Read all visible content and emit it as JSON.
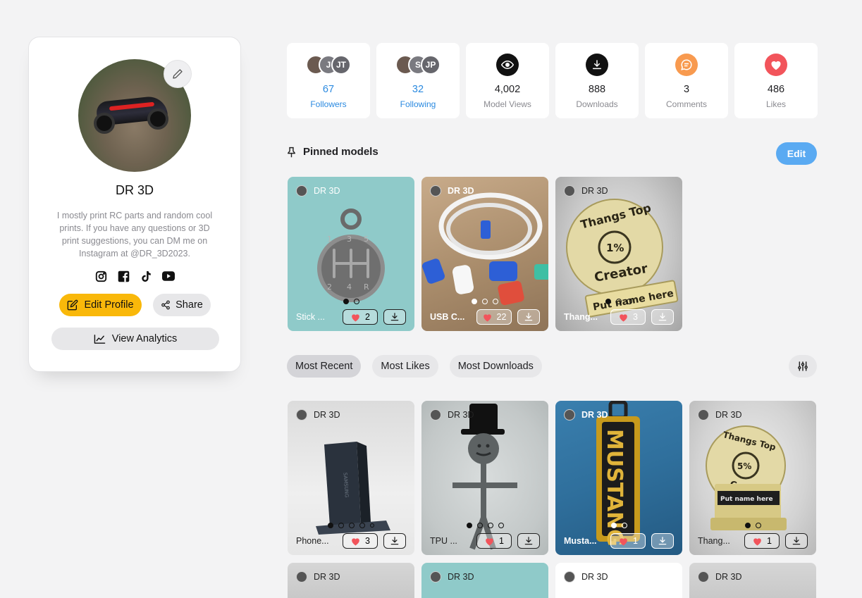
{
  "profile": {
    "name": "DR 3D",
    "bio": "I mostly print RC parts and random cool prints. If you have any questions or 3D print suggestions, you can DM me on Instagram at @DR_3D2023.",
    "socials": [
      "instagram-icon",
      "facebook-icon",
      "tiktok-icon",
      "youtube-icon"
    ],
    "edit_profile_label": "Edit Profile",
    "share_label": "Share",
    "view_analytics_label": "View Analytics"
  },
  "stats": {
    "followers": {
      "value": "67",
      "label": "Followers",
      "avatars": [
        "",
        "J",
        "JT"
      ]
    },
    "following": {
      "value": "32",
      "label": "Following",
      "avatars": [
        "",
        "S",
        "JP"
      ]
    },
    "views": {
      "value": "4,002",
      "label": "Model Views"
    },
    "downloads": {
      "value": "888",
      "label": "Downloads"
    },
    "comments": {
      "value": "3",
      "label": "Comments"
    },
    "likes": {
      "value": "486",
      "label": "Likes"
    }
  },
  "pinned": {
    "title": "Pinned models",
    "edit_label": "Edit",
    "models": [
      {
        "author": "DR 3D",
        "title": "Stick ...",
        "likes": "2"
      },
      {
        "author": "DR 3D",
        "title": "USB C...",
        "likes": "22"
      },
      {
        "author": "DR 3D",
        "title": "Thang...",
        "likes": "3"
      }
    ]
  },
  "tabs": [
    "Most Recent",
    "Most Likes",
    "Most Downloads"
  ],
  "models": [
    {
      "author": "DR 3D",
      "title": "Phone...",
      "likes": "3"
    },
    {
      "author": "DR 3D",
      "title": "TPU ...",
      "likes": "1"
    },
    {
      "author": "DR 3D",
      "title": "Musta...",
      "likes": "1"
    },
    {
      "author": "DR 3D",
      "title": "Thang...",
      "likes": "1"
    },
    {
      "author": "DR 3D"
    },
    {
      "author": "DR 3D"
    },
    {
      "author": "DR 3D"
    },
    {
      "author": "DR 3D"
    }
  ],
  "thumb_art": {
    "gear_numbers": [
      "1",
      "3",
      "5",
      "2",
      "4",
      "R"
    ],
    "coin_top": "Thangs Top",
    "coin_percent_1": "1%",
    "coin_percent_2": "5%",
    "coin_creator": "Creator",
    "coin_plate": "Put name here",
    "phone_brand": "SAMSUNG",
    "mustang_text": "MUSTANG"
  },
  "colors": {
    "accent_yellow": "#f9b80a",
    "accent_blue": "#5aaaf2",
    "link_blue": "#2b8ae0",
    "heart_red": "#f2545b",
    "comment_orange": "#f89a4f"
  }
}
